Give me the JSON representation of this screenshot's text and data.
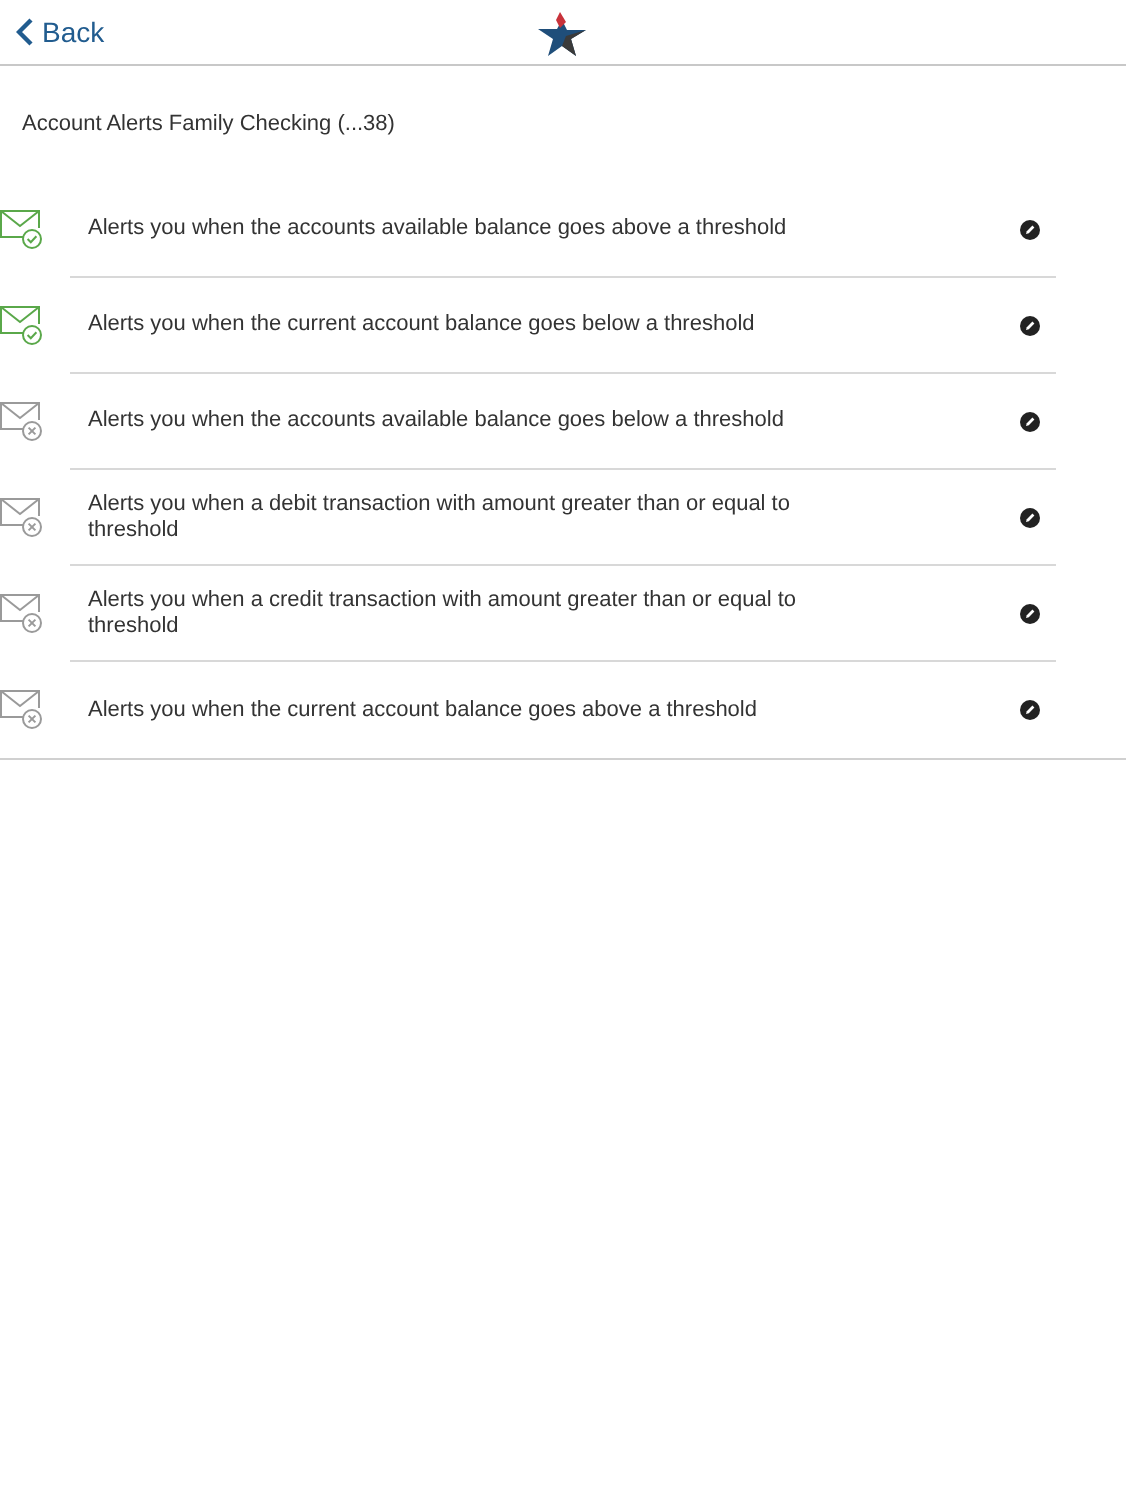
{
  "header": {
    "back_label": "Back"
  },
  "title": "Account Alerts Family Checking (...38)",
  "alerts": [
    {
      "text": "Alerts you when the accounts available balance goes above a threshold",
      "enabled": true
    },
    {
      "text": "Alerts you when the current account balance goes below a threshold",
      "enabled": true
    },
    {
      "text": "Alerts you when the accounts available balance goes below a threshold",
      "enabled": false
    },
    {
      "text": "Alerts you when a debit transaction with amount greater than or equal to threshold",
      "enabled": false
    },
    {
      "text": "Alerts you when a credit transaction with amount greater than or equal to threshold",
      "enabled": false
    },
    {
      "text": "Alerts you when the current account balance goes above a threshold",
      "enabled": false
    }
  ]
}
